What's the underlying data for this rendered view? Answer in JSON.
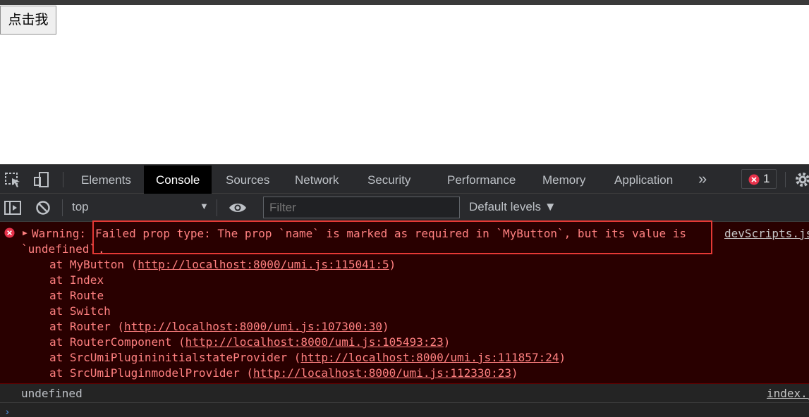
{
  "page": {
    "button_label": "点击我"
  },
  "devtools": {
    "tabs": [
      "Elements",
      "Console",
      "Sources",
      "Network",
      "Security",
      "Performance",
      "Memory",
      "Application"
    ],
    "active_tab": "Console",
    "more_tabs_glyph": "»",
    "error_count": "1",
    "context": "top",
    "filter_placeholder": "Filter",
    "levels": "Default levels ▼"
  },
  "console": {
    "error": {
      "prefix": "Warning: ",
      "message_line1": "Failed prop type: The prop `name` is marked as required in `MyButton`, but its value is",
      "message_line2_a": "`undefined`",
      "message_line2_b": ".",
      "source": "devScripts.js",
      "stack": [
        {
          "fn": "MyButton",
          "url": "http://localhost:8000/umi.js:115041:5"
        },
        {
          "fn": "Index",
          "url": ""
        },
        {
          "fn": "Route",
          "url": ""
        },
        {
          "fn": "Switch",
          "url": ""
        },
        {
          "fn": "Router",
          "url": "http://localhost:8000/umi.js:107300:30"
        },
        {
          "fn": "RouterComponent",
          "url": "http://localhost:8000/umi.js:105493:23"
        },
        {
          "fn": "SrcUmiPlugininitialstateProvider",
          "url": "http://localhost:8000/umi.js:111857:24"
        },
        {
          "fn": "SrcUmiPluginmodelProvider",
          "url": "http://localhost:8000/umi.js:112330:23"
        }
      ]
    },
    "log": {
      "value": "undefined",
      "source": "index.js"
    },
    "prompt_glyph": "›"
  },
  "colors": {
    "error_text": "#ff8080",
    "error_bg": "#290000",
    "highlight": "#e53935",
    "devtools_bg": "#292a2d"
  }
}
